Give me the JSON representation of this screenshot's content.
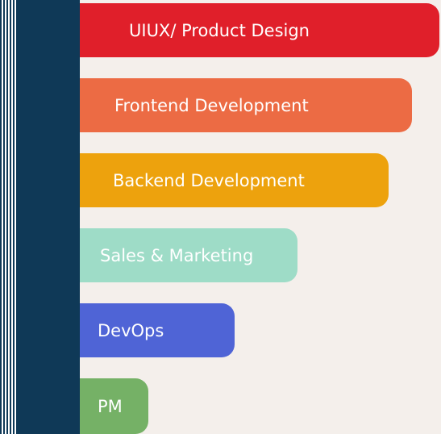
{
  "items": [
    {
      "label": "UIUX/ Product Design",
      "color": "#e01f2a"
    },
    {
      "label": "Frontend Development",
      "color": "#ec6b44"
    },
    {
      "label": "Backend Development",
      "color": "#eda20d"
    },
    {
      "label": "Sales & Marketing",
      "color": "#9edcc7"
    },
    {
      "label": "DevOps",
      "color": "#4f64d6"
    },
    {
      "label": "PM",
      "color": "#75b166"
    }
  ],
  "colors": {
    "background": "#f4efeb",
    "spine": "#0f3957"
  }
}
